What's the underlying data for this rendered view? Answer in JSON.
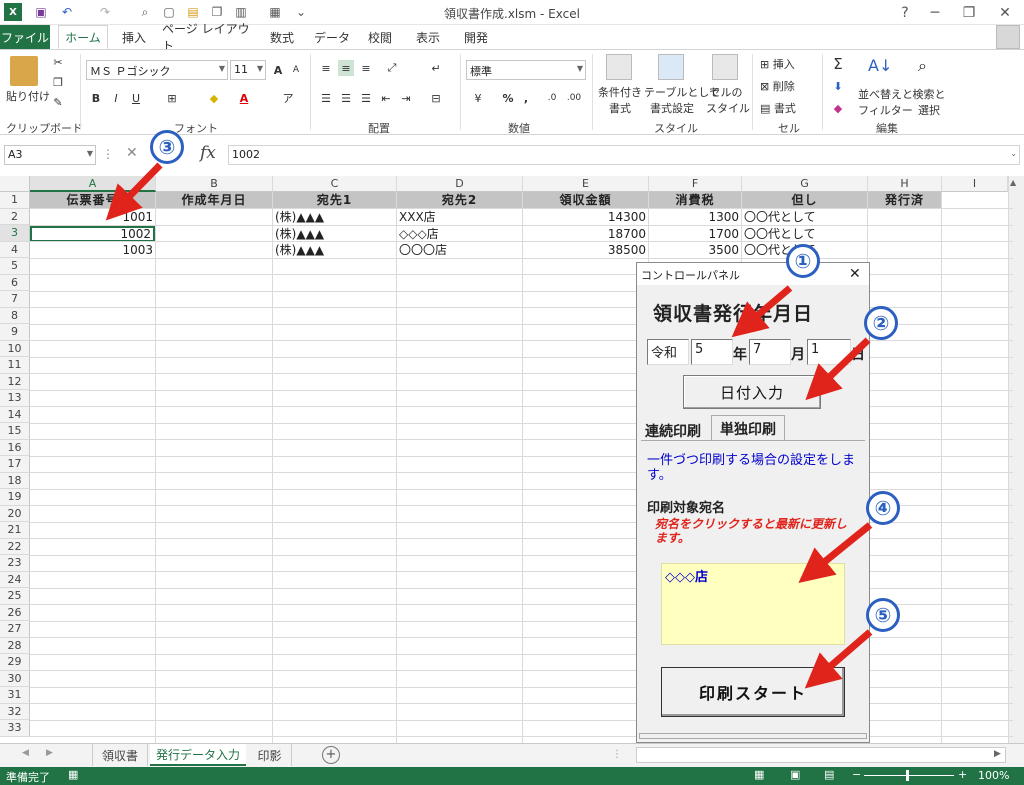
{
  "window": {
    "title": "領収書作成.xlsm - Excel",
    "help": "?",
    "minimize": "─",
    "restore": "❐",
    "close": "✕"
  },
  "quick_access": {
    "excel_icon": "X",
    "save": "💾",
    "undo": "↶",
    "redo": "↷"
  },
  "tabs": [
    "ファイル",
    "ホーム",
    "挿入",
    "ページ レイアウト",
    "数式",
    "データ",
    "校閲",
    "表示",
    "開発"
  ],
  "ribbon": {
    "clipboard": {
      "label": "クリップボード",
      "paste": "貼り付け"
    },
    "font": {
      "label": "フォント",
      "font_name": "ＭＳ Ｐゴシック",
      "font_size": "11",
      "bold": "B",
      "italic": "I",
      "underline": "U",
      "grow": "A",
      "shrink": "A"
    },
    "alignment": {
      "label": "配置"
    },
    "number": {
      "label": "数値",
      "format": "標準",
      "percent": "%",
      "comma": ","
    },
    "styles": {
      "label": "スタイル",
      "conditional": [
        "条件付き",
        "書式"
      ],
      "table": [
        "テーブルとして",
        "書式設定"
      ],
      "cell_styles": [
        "セルの",
        "スタイル"
      ]
    },
    "cells": {
      "label": "セル",
      "insert": "挿入",
      "delete": "削除",
      "format": "書式"
    },
    "editing": {
      "label": "編集",
      "sort": [
        "並べ替えと",
        "フィルター"
      ],
      "find": [
        "検索と",
        "選択"
      ],
      "sigma": "Σ"
    }
  },
  "formula_bar": {
    "name_box": "A3",
    "fx": "fx",
    "value": "1002",
    "cancel": "✕"
  },
  "grid": {
    "columns": [
      "A",
      "B",
      "C",
      "D",
      "E",
      "F",
      "G",
      "H",
      "I"
    ],
    "header_row": [
      "伝票番号",
      "作成年月日",
      "宛先1",
      "宛先2",
      "領収金額",
      "消費税",
      "但し",
      "発行済",
      ""
    ],
    "rows": [
      {
        "a": "1001",
        "c": "(株)▲▲▲",
        "d": "XXX店",
        "e": "14300",
        "f": "1300",
        "g": "〇〇代として"
      },
      {
        "a": "1002",
        "c": "(株)▲▲▲",
        "d": "◇◇◇店",
        "e": "18700",
        "f": "1700",
        "g": "〇〇代として"
      },
      {
        "a": "1003",
        "c": "(株)▲▲▲",
        "d": "〇〇〇店",
        "e": "38500",
        "f": "3500",
        "g": "〇〇代として"
      }
    ],
    "row_numbers": [
      "1",
      "2",
      "3",
      "4",
      "5",
      "6",
      "7",
      "8",
      "9",
      "10",
      "11",
      "12",
      "13",
      "14",
      "15",
      "16",
      "17",
      "18",
      "19",
      "20",
      "21",
      "22",
      "23",
      "24",
      "25",
      "26",
      "27",
      "28",
      "29",
      "30",
      "31",
      "32",
      "33"
    ]
  },
  "sheets": [
    "領収書",
    "発行データ入力",
    "印影"
  ],
  "add_sheet": "+",
  "status": {
    "ready": "準備完了",
    "zoom": "100%",
    "minus": "−",
    "plus": "+"
  },
  "control_panel": {
    "title": "コントロールパネル",
    "close": "✕",
    "heading": "領収書発行年月日",
    "era": "令和",
    "year": "5",
    "year_unit": "年",
    "month": "7",
    "month_unit": "月",
    "day": "1",
    "day_unit": "日",
    "date_button": "日付入力",
    "tab_continuous": "連続印刷",
    "tab_single": "単独印刷",
    "description": "一件づつ印刷する場合の設定をします。",
    "target_label": "印刷対象宛名",
    "hint": "宛名をクリックすると最新に更新します。",
    "selected": "◇◇◇店",
    "print_button": "印刷スタート"
  },
  "callouts": [
    "①",
    "②",
    "③",
    "④",
    "⑤"
  ],
  "colors": {
    "excel_green": "#217346",
    "callout_blue": "#2b5fc0",
    "arrow_red": "#e0241c",
    "list_yellow": "#ffffc0",
    "hint_red": "#e0241c",
    "desc_blue": "#0000cc"
  }
}
